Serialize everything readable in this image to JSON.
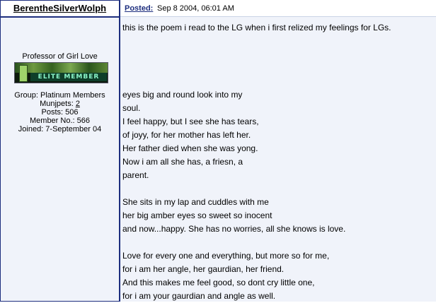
{
  "user": {
    "name": "BerentheSilverWolph",
    "title": "Professor of Girl Love",
    "badge_text": "ELITE MEMBER",
    "group": "Group: Platinum Members",
    "munjpets_label": "Munjpets: ",
    "munjpets_value": "2",
    "posts": "Posts: 506",
    "member_no": "Member No.: 566",
    "joined": "Joined: 7-September 04"
  },
  "post": {
    "posted_label": "Posted:",
    "date": "Sep 8 2004, 06:01 AM",
    "body": "this is the poem i read to the LG when i first relized my feelings for LGs.\n\n\n\n\neyes big and round look into my\nsoul.\nI feel happy, but I see she has tears,\nof joyy, for her mother has left her.\nHer father died when she was yong.\nNow i am all she has, a friesn, a\nparent.\n\nShe sits in my lap and cuddles with me\nher big amber eyes so sweet so inocent\nand now...happy. She has no worries, all she knows is love.\n\nLove for every one and everything, but more so for me,\nfor i am her angle, her gaurdian, her friend.\nAnd this makes me feel good, so dont cry little one,\nfor i am your gaurdian and angle as well."
  }
}
